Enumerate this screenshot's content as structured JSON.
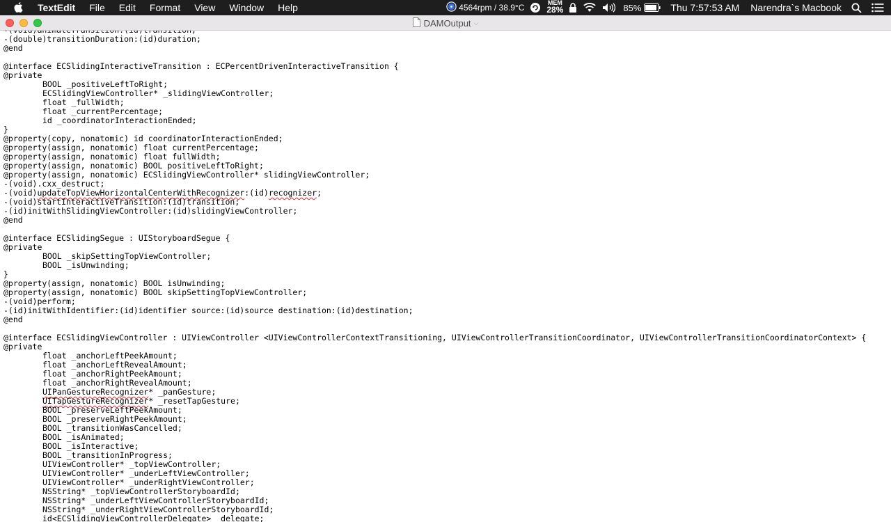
{
  "menubar": {
    "app_name": "TextEdit",
    "menus": [
      "File",
      "Edit",
      "Format",
      "View",
      "Window",
      "Help"
    ],
    "fan_stats": "4564rpm / 38.9°C",
    "mem_label": "MEM",
    "mem_value": "28%",
    "battery_percent": "85%",
    "clock": "Thu 7:57:53 AM",
    "user_name": "Narendra`s Macbook",
    "icons": [
      "apple-logo",
      "fan-icon",
      "rotate-icon",
      "lock-icon",
      "wifi-icon",
      "volume-icon",
      "battery-icon",
      "search-icon",
      "list-icon"
    ]
  },
  "window": {
    "title": "DAMOutput"
  },
  "document": {
    "lines": [
      {
        "ind": "",
        "text": "-(void)animateTransition:(id)transition;"
      },
      {
        "ind": "",
        "text": "-(double)transitionDuration:(id)duration;"
      },
      {
        "ind": "",
        "text": "@end"
      },
      {
        "ind": "",
        "text": ""
      },
      {
        "ind": "",
        "text": "@interface ECSlidingInteractiveTransition : ECPercentDrivenInteractiveTransition {"
      },
      {
        "ind": "",
        "text": "@private"
      },
      {
        "ind": "1",
        "text": "BOOL _positiveLeftToRight;"
      },
      {
        "ind": "1",
        "text": "ECSlidingViewController* _slidingViewController;"
      },
      {
        "ind": "1",
        "text": "float _fullWidth;"
      },
      {
        "ind": "1",
        "text": "float _currentPercentage;"
      },
      {
        "ind": "1",
        "text": "id _coordinatorInteractionEnded;"
      },
      {
        "ind": "",
        "text": "}"
      },
      {
        "ind": "",
        "text": "@property(copy, nonatomic) id coordinatorInteractionEnded;"
      },
      {
        "ind": "",
        "text": "@property(assign, nonatomic) float currentPercentage;"
      },
      {
        "ind": "",
        "text": "@property(assign, nonatomic) float fullWidth;"
      },
      {
        "ind": "",
        "text": "@property(assign, nonatomic) BOOL positiveLeftToRight;"
      },
      {
        "ind": "",
        "text": "@property(assign, nonatomic) ECSlidingViewController* slidingViewController;"
      },
      {
        "ind": "",
        "text": "-(void).cxx_destruct;"
      },
      {
        "ind": "",
        "pre": "-(void)",
        "sq": "updateTopViewHorizontalCenterWithRecognizer",
        "mid": ":(id)",
        "sq2": "recognizer",
        "post": ";"
      },
      {
        "ind": "",
        "text": "-(void)startInteractiveTransition:(id)transition;"
      },
      {
        "ind": "",
        "text": "-(id)initWithSlidingViewController:(id)slidingViewController;"
      },
      {
        "ind": "",
        "text": "@end"
      },
      {
        "ind": "",
        "text": ""
      },
      {
        "ind": "",
        "text": "@interface ECSlidingSegue : UIStoryboardSegue {"
      },
      {
        "ind": "",
        "text": "@private"
      },
      {
        "ind": "1",
        "text": "BOOL _skipSettingTopViewController;"
      },
      {
        "ind": "1",
        "text": "BOOL _isUnwinding;"
      },
      {
        "ind": "",
        "text": "}"
      },
      {
        "ind": "",
        "text": "@property(assign, nonatomic) BOOL isUnwinding;"
      },
      {
        "ind": "",
        "text": "@property(assign, nonatomic) BOOL skipSettingTopViewController;"
      },
      {
        "ind": "",
        "text": "-(void)perform;"
      },
      {
        "ind": "",
        "text": "-(id)initWithIdentifier:(id)identifier source:(id)source destination:(id)destination;"
      },
      {
        "ind": "",
        "text": "@end"
      },
      {
        "ind": "",
        "text": ""
      },
      {
        "ind": "",
        "text": "@interface ECSlidingViewController : UIViewController <UIViewControllerContextTransitioning, UIViewControllerTransitionCoordinator, UIViewControllerTransitionCoordinatorContext> {"
      },
      {
        "ind": "",
        "text": "@private"
      },
      {
        "ind": "1",
        "text": "float _anchorLeftPeekAmount;"
      },
      {
        "ind": "1",
        "text": "float _anchorLeftRevealAmount;"
      },
      {
        "ind": "1",
        "text": "float _anchorRightPeekAmount;"
      },
      {
        "ind": "1",
        "text": "float _anchorRightRevealAmount;"
      },
      {
        "ind": "1",
        "pre": "",
        "sq": "UIPanGestureRecognizer",
        "mid": "* _panGesture;",
        "sq2": "",
        "post": ""
      },
      {
        "ind": "1",
        "pre": "",
        "sq": "UITapGestureRecognizer",
        "mid": "* _resetTapGesture;",
        "sq2": "",
        "post": ""
      },
      {
        "ind": "1",
        "text": "BOOL _preserveLeftPeekAmount;"
      },
      {
        "ind": "1",
        "text": "BOOL _preserveRightPeekAmount;"
      },
      {
        "ind": "1",
        "text": "BOOL _transitionWasCancelled;"
      },
      {
        "ind": "1",
        "text": "BOOL _isAnimated;"
      },
      {
        "ind": "1",
        "text": "BOOL _isInteractive;"
      },
      {
        "ind": "1",
        "text": "BOOL _transitionInProgress;"
      },
      {
        "ind": "1",
        "text": "UIViewController* _topViewController;"
      },
      {
        "ind": "1",
        "text": "UIViewController* _underLeftViewController;"
      },
      {
        "ind": "1",
        "text": "UIViewController* _underRightViewController;"
      },
      {
        "ind": "1",
        "text": "NSString* _topViewControllerStoryboardId;"
      },
      {
        "ind": "1",
        "text": "NSString* _underLeftViewControllerStoryboardId;"
      },
      {
        "ind": "1",
        "text": "NSString* _underRightViewControllerStoryboardId;"
      },
      {
        "ind": "1",
        "text": "id<ECSlidingViewControllerDelegate> _delegate;"
      }
    ]
  }
}
